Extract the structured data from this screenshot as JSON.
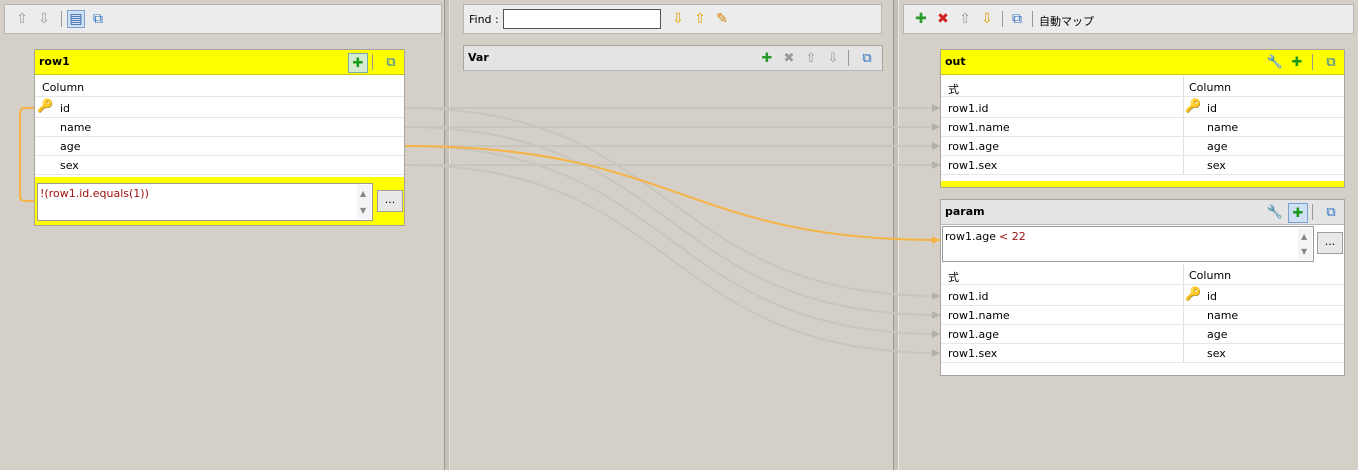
{
  "left": {
    "table": {
      "title": "row1",
      "header": "Column",
      "rows": [
        "id",
        "name",
        "age",
        "sex"
      ],
      "filter_expr": "!(row1.id.equals(1))",
      "more_label": "..."
    }
  },
  "center": {
    "find_label": "Find :",
    "find_value": "",
    "var_title": "Var"
  },
  "right": {
    "automap_label": "自動マップ",
    "out": {
      "title": "out",
      "col_expr": "式",
      "col_column": "Column",
      "rows": [
        {
          "expr": "row1.id",
          "column": "id"
        },
        {
          "expr": "row1.name",
          "column": "name"
        },
        {
          "expr": "row1.age",
          "column": "age"
        },
        {
          "expr": "row1.sex",
          "column": "sex"
        }
      ]
    },
    "param": {
      "title": "param",
      "filter_var": "row1.age",
      "filter_op": "< 22",
      "more_label": "...",
      "col_expr": "式",
      "col_column": "Column",
      "rows": [
        {
          "expr": "row1.id",
          "column": "id"
        },
        {
          "expr": "row1.name",
          "column": "name"
        },
        {
          "expr": "row1.age",
          "column": "age"
        },
        {
          "expr": "row1.sex",
          "column": "sex"
        }
      ]
    }
  },
  "colors": {
    "header_yellow": "#ffff00",
    "link_orange": "#f5b342",
    "link_grey": "#c8c6bc",
    "expr_red": "#a01010"
  }
}
